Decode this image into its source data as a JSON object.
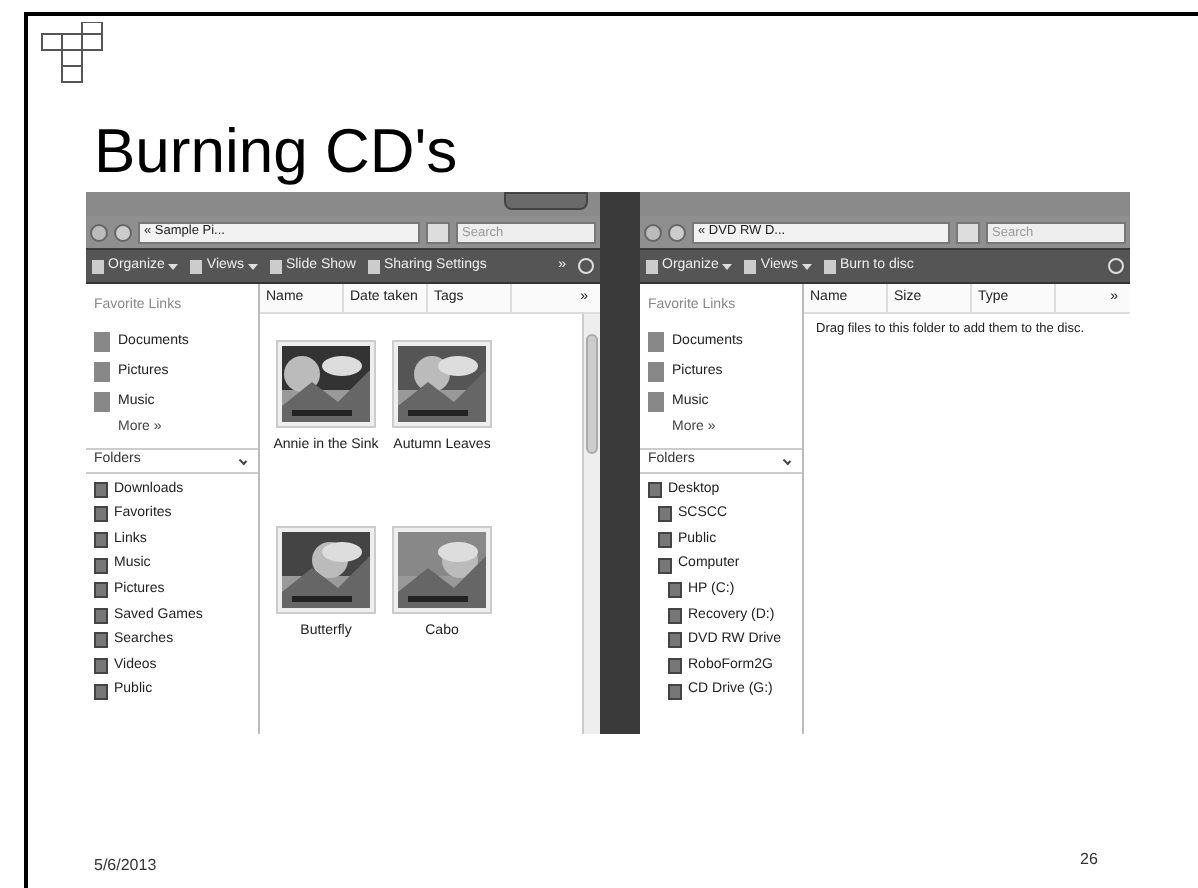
{
  "slide": {
    "title": "Burning CD's",
    "date": "5/6/2013",
    "page_number": "26"
  },
  "windows": [
    {
      "address": "« Sample Pi...",
      "search_placeholder": "Search",
      "toolbar": [
        "Organize",
        "Views",
        "Slide Show",
        "Sharing Settings"
      ],
      "toolbar_overflow": "»",
      "favorites_heading": "Favorite Links",
      "favorites": [
        "Documents",
        "Pictures",
        "Music"
      ],
      "more": "More »",
      "folders_heading": "Folders",
      "folders": [
        {
          "label": "Downloads"
        },
        {
          "label": "Favorites"
        },
        {
          "label": "Links"
        },
        {
          "label": "Music"
        },
        {
          "label": "Pictures"
        },
        {
          "label": "Saved Games"
        },
        {
          "label": "Searches"
        },
        {
          "label": "Videos"
        },
        {
          "label": "Public"
        }
      ],
      "columns": [
        "Name",
        "Date taken",
        "Tags"
      ],
      "columns_overflow": "»",
      "files": [
        {
          "name": "Annie in the Sink",
          "kind": "picture"
        },
        {
          "name": "Autumn Leaves",
          "kind": "picture"
        },
        {
          "name": "Butterfly",
          "kind": "picture"
        },
        {
          "name": "Cabo",
          "kind": "picture"
        }
      ]
    },
    {
      "address": "« DVD RW D...",
      "search_placeholder": "Search",
      "toolbar": [
        "Organize",
        "Views",
        "Burn to disc"
      ],
      "favorites_heading": "Favorite Links",
      "favorites": [
        "Documents",
        "Pictures",
        "Music"
      ],
      "more": "More »",
      "folders_heading": "Folders",
      "folders": [
        {
          "label": "Desktop",
          "children": [
            {
              "label": "SCSCC"
            },
            {
              "label": "Public"
            },
            {
              "label": "Computer",
              "children": [
                {
                  "label": "HP (C:)"
                },
                {
                  "label": "Recovery (D:)"
                },
                {
                  "label": "DVD RW Drive"
                },
                {
                  "label": "RoboForm2G"
                },
                {
                  "label": "CD Drive (G:)"
                }
              ]
            }
          ]
        }
      ],
      "columns": [
        "Name",
        "Size",
        "Type"
      ],
      "columns_overflow": "»",
      "empty_message": "Drag files to this folder to add them to the disc."
    }
  ]
}
